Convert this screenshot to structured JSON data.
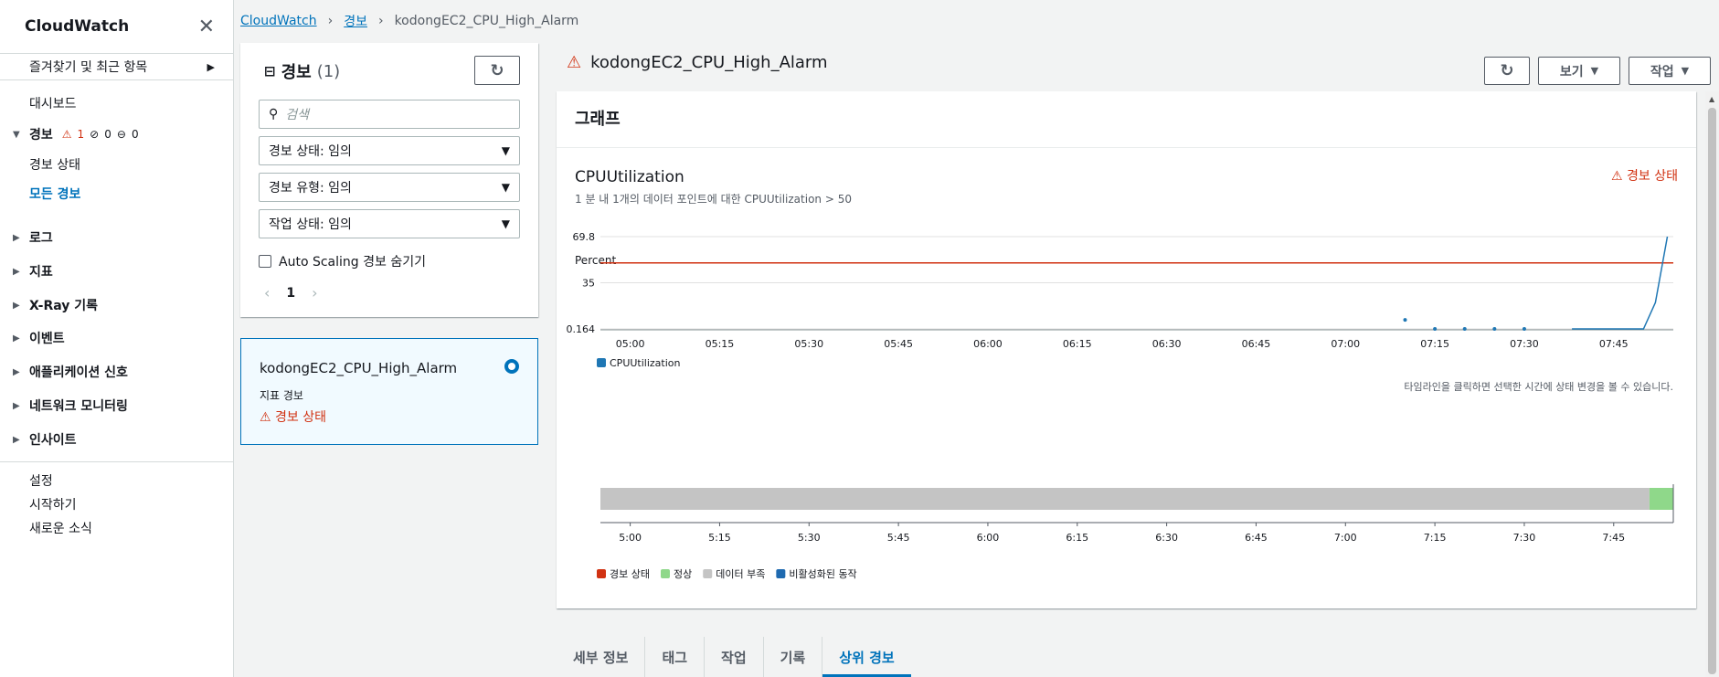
{
  "sidebar": {
    "title": "CloudWatch",
    "favorites": "즐겨찾기 및 최근 항목",
    "dashboard": "대시보드",
    "alarms": {
      "label": "경보",
      "alarm_count": "1",
      "ok_count": "0",
      "insufficient_count": "0"
    },
    "alarm_state": "경보 상태",
    "all_alarms": "모든 경보",
    "groups": [
      "로그",
      "지표",
      "X-Ray 기록",
      "이벤트",
      "애플리케이션 신호",
      "네트워크 모니터링",
      "인사이트"
    ],
    "settings": "설정",
    "getting_started": "시작하기",
    "whats_new": "새로운 소식"
  },
  "breadcrumb": {
    "root": "CloudWatch",
    "alarms": "경보",
    "current": "kodongEC2_CPU_High_Alarm"
  },
  "alarm_list": {
    "title": "경보",
    "count": "(1)",
    "search_placeholder": "검색",
    "filters": [
      "경보 상태: 임의",
      "경보 유형: 임의",
      "작업 상태: 임의"
    ],
    "hide_autoscaling": "Auto Scaling 경보 숨기기",
    "page": "1",
    "item": {
      "name": "kodongEC2_CPU_High_Alarm",
      "type": "지표 경보",
      "state": "경보 상태"
    }
  },
  "detail": {
    "title": "kodongEC2_CPU_High_Alarm",
    "view_button": "보기",
    "actions_button": "작업",
    "graph_heading": "그래프",
    "metric_name": "CPUUtilization",
    "metric_condition": "1 분 내 1개의 데이터 포인트에 대한 CPUUtilization > 50",
    "state_badge": "경보 상태",
    "timeline_hint": "타임라인을 클릭하면 선택한 시간에 상태 변경을 볼 수 있습니다."
  },
  "chart_data": {
    "type": "line",
    "ylabel": "Percent",
    "yticks": [
      "69.8",
      "35",
      "0.164"
    ],
    "ylim": [
      0.164,
      69.8
    ],
    "xticks": [
      "05:00",
      "05:15",
      "05:30",
      "05:45",
      "06:00",
      "06:15",
      "06:30",
      "06:45",
      "07:00",
      "07:15",
      "07:30",
      "07:45"
    ],
    "threshold": 50,
    "threshold_color": "#d13212",
    "series": [
      {
        "name": "CPUUtilization",
        "color": "#1f77b4",
        "points": [
          [
            "07:10",
            7
          ],
          [
            "07:15",
            0.164
          ],
          [
            "07:20",
            0.164
          ],
          [
            "07:25",
            0.164
          ],
          [
            "07:30",
            0.164
          ],
          [
            "07:38",
            0.164
          ],
          [
            "07:40",
            0.164
          ],
          [
            "07:42",
            0.164
          ],
          [
            "07:44",
            0.164
          ],
          [
            "07:46",
            0.164
          ],
          [
            "07:48",
            0.164
          ],
          [
            "07:50",
            0.164
          ],
          [
            "07:52",
            20
          ],
          [
            "07:54",
            69.8
          ]
        ]
      }
    ],
    "timeline": {
      "ticks": [
        "5:00",
        "5:15",
        "5:30",
        "5:45",
        "6:00",
        "6:15",
        "6:30",
        "6:45",
        "7:00",
        "7:15",
        "7:30",
        "7:45"
      ],
      "segments": [
        {
          "from": "4:55",
          "to": "7:51",
          "state": "데이터 부족"
        },
        {
          "from": "7:51",
          "to": "7:55",
          "state": "정상"
        }
      ]
    },
    "legend": [
      {
        "label": "경보 상태",
        "color": "#d13212"
      },
      {
        "label": "정상",
        "color": "#8fd88a"
      },
      {
        "label": "데이터 부족",
        "color": "#c4c4c4"
      },
      {
        "label": "비활성화된 동작",
        "color": "#1f6ab0"
      }
    ]
  },
  "tabs": [
    "세부 정보",
    "태그",
    "작업",
    "기록",
    "상위 경보"
  ]
}
